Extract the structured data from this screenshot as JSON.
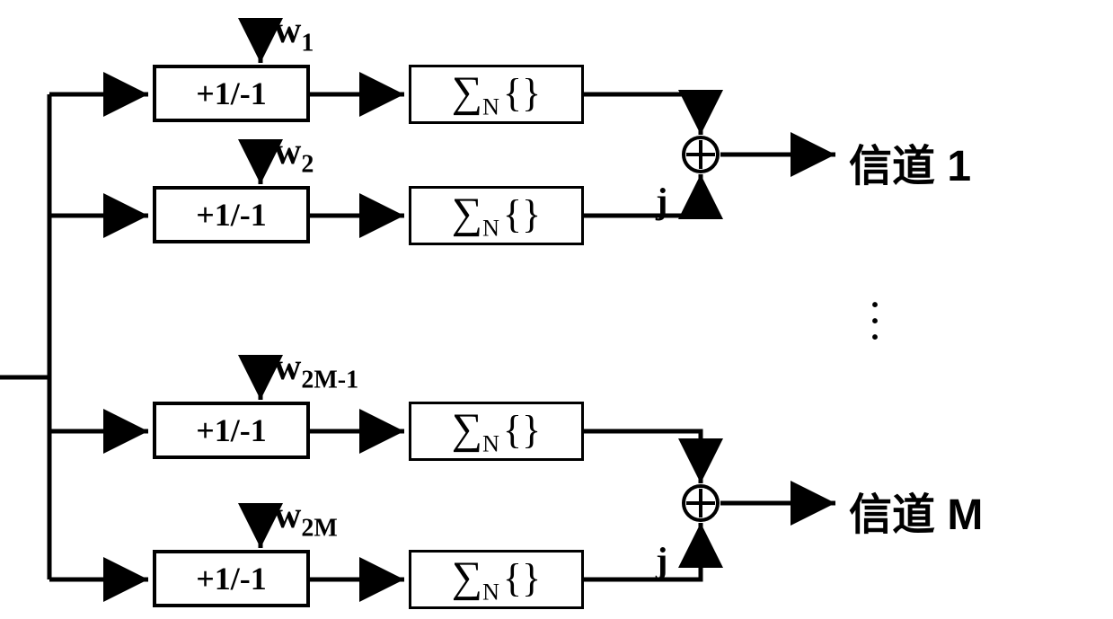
{
  "weights": {
    "w1": {
      "base": "w",
      "sub": "1"
    },
    "w2": {
      "base": "w",
      "sub": "2"
    },
    "w2m1": {
      "base": "w",
      "sub": "2M-1"
    },
    "w2m": {
      "base": "w",
      "sub": "2M"
    }
  },
  "sign_block": "+1/-1",
  "sum_label_sigma": "∑",
  "sum_label_sub": "N",
  "sum_label_braces": "{}",
  "j_label": "j",
  "output1": "信道 1",
  "outputM": "信道 M",
  "ellipsis": "⋮"
}
